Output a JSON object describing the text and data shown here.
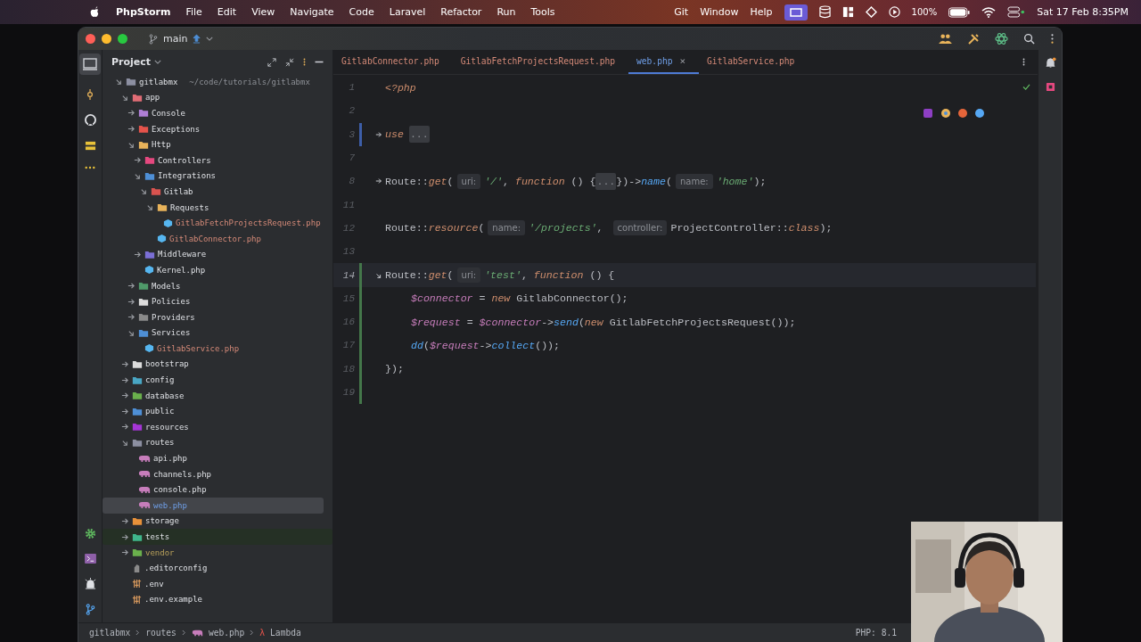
{
  "menu_bar": {
    "app": "PhpStorm",
    "items": [
      "File",
      "Edit",
      "View",
      "Navigate",
      "Code",
      "Laravel",
      "Refactor",
      "Run",
      "Tools"
    ],
    "right_items": [
      "Git",
      "Window",
      "Help"
    ],
    "battery": "100%",
    "clock": "Sat 17 Feb  8:35PM"
  },
  "title_bar": {
    "branch": "main"
  },
  "project": {
    "title": "Project",
    "tree": [
      {
        "name": "gitlabmx",
        "location": "~/code/tutorials/gitlabmx",
        "kind": "folder",
        "color": "#8c8fa1",
        "expanded": true,
        "selected": false,
        "unversioned": false,
        "modified": false,
        "excluded": false,
        "test_root": false,
        "children": [
          {
            "name": "app",
            "kind": "folder",
            "color": "#e06c75",
            "expanded": true,
            "selected": false,
            "unversioned": false,
            "modified": false,
            "excluded": false,
            "test_root": false,
            "children": [
              {
                "name": "Console",
                "kind": "folder",
                "color": "#b07fd6",
                "expanded": false,
                "selected": false,
                "unversioned": false,
                "modified": false,
                "excluded": false,
                "test_root": false
              },
              {
                "name": "Exceptions",
                "kind": "folder",
                "color": "#e5534b",
                "expanded": false,
                "selected": false,
                "unversioned": false,
                "modified": false,
                "excluded": false,
                "test_root": false
              },
              {
                "name": "Http",
                "kind": "folder",
                "color": "#e8b35a",
                "expanded": true,
                "selected": false,
                "unversioned": false,
                "modified": false,
                "excluded": false,
                "test_root": false,
                "children": [
                  {
                    "name": "Controllers",
                    "kind": "folder",
                    "color": "#e5487f",
                    "expanded": false,
                    "selected": false,
                    "unversioned": false,
                    "modified": false,
                    "excluded": false,
                    "test_root": false
                  },
                  {
                    "name": "Integrations",
                    "kind": "folder",
                    "color": "#4e8fd6",
                    "expanded": true,
                    "selected": false,
                    "unversioned": false,
                    "modified": false,
                    "excluded": false,
                    "test_root": false,
                    "children": [
                      {
                        "name": "Gitlab",
                        "kind": "folder",
                        "color": "#d9534f",
                        "expanded": true,
                        "selected": false,
                        "unversioned": false,
                        "modified": false,
                        "excluded": false,
                        "test_root": false,
                        "children": [
                          {
                            "name": "Requests",
                            "kind": "folder",
                            "color": "#e8b35a",
                            "expanded": true,
                            "selected": false,
                            "unversioned": false,
                            "modified": false,
                            "excluded": false,
                            "test_root": false,
                            "children": [
                              {
                                "name": "GitlabFetchProjectsRequest.php",
                                "kind": "php",
                                "color": "#56b6f0",
                                "selected": false,
                                "unversioned": true,
                                "modified": false,
                                "excluded": false,
                                "test_root": false
                              }
                            ]
                          },
                          {
                            "name": "GitlabConnector.php",
                            "kind": "php",
                            "color": "#56b6f0",
                            "selected": false,
                            "unversioned": true,
                            "modified": false,
                            "excluded": false,
                            "test_root": false
                          }
                        ]
                      }
                    ]
                  },
                  {
                    "name": "Middleware",
                    "kind": "folder",
                    "color": "#7b6fd6",
                    "expanded": false,
                    "selected": false,
                    "unversioned": false,
                    "modified": false,
                    "excluded": false,
                    "test_root": false
                  },
                  {
                    "name": "Kernel.php",
                    "kind": "php",
                    "color": "#56b6f0",
                    "selected": false,
                    "unversioned": false,
                    "modified": false,
                    "excluded": false,
                    "test_root": false
                  }
                ]
              },
              {
                "name": "Models",
                "kind": "folder",
                "color": "#4f9a6a",
                "expanded": false,
                "selected": false,
                "unversioned": false,
                "modified": false,
                "excluded": false,
                "test_root": false
              },
              {
                "name": "Policies",
                "kind": "folder",
                "color": "#dcdcdc",
                "expanded": false,
                "selected": false,
                "unversioned": false,
                "modified": false,
                "excluded": false,
                "test_root": false
              },
              {
                "name": "Providers",
                "kind": "folder",
                "color": "#8a8a8a",
                "expanded": false,
                "selected": false,
                "unversioned": false,
                "modified": false,
                "excluded": false,
                "test_root": false
              },
              {
                "name": "Services",
                "kind": "folder",
                "color": "#4e8fd6",
                "expanded": true,
                "selected": false,
                "unversioned": false,
                "modified": false,
                "excluded": false,
                "test_root": false,
                "children": [
                  {
                    "name": "GitlabService.php",
                    "kind": "php",
                    "color": "#56b6f0",
                    "selected": false,
                    "unversioned": true,
                    "modified": false,
                    "excluded": false,
                    "test_root": false
                  }
                ]
              }
            ]
          },
          {
            "name": "bootstrap",
            "kind": "folder",
            "color": "#dcdcdc",
            "expanded": false,
            "selected": false,
            "unversioned": false,
            "modified": false,
            "excluded": false,
            "test_root": false
          },
          {
            "name": "config",
            "kind": "folder",
            "color": "#49a6c4",
            "expanded": false,
            "selected": false,
            "unversioned": false,
            "modified": false,
            "excluded": false,
            "test_root": false
          },
          {
            "name": "database",
            "kind": "folder",
            "color": "#6ab04c",
            "expanded": false,
            "selected": false,
            "unversioned": false,
            "modified": false,
            "excluded": false,
            "test_root": false
          },
          {
            "name": "public",
            "kind": "folder",
            "color": "#4e8fd6",
            "expanded": false,
            "selected": false,
            "unversioned": false,
            "modified": false,
            "excluded": false,
            "test_root": false
          },
          {
            "name": "resources",
            "kind": "folder",
            "color": "#a535d6",
            "expanded": false,
            "selected": false,
            "unversioned": false,
            "modified": false,
            "excluded": false,
            "test_root": false
          },
          {
            "name": "routes",
            "kind": "folder",
            "color": "#8c8fa1",
            "expanded": true,
            "selected": false,
            "unversioned": false,
            "modified": false,
            "excluded": false,
            "test_root": false,
            "children": [
              {
                "name": "api.php",
                "kind": "laravel",
                "color": "#c77dbb",
                "selected": false,
                "unversioned": false,
                "modified": false,
                "excluded": false,
                "test_root": false
              },
              {
                "name": "channels.php",
                "kind": "laravel",
                "color": "#c77dbb",
                "selected": false,
                "unversioned": false,
                "modified": false,
                "excluded": false,
                "test_root": false
              },
              {
                "name": "console.php",
                "kind": "laravel",
                "color": "#c77dbb",
                "selected": false,
                "unversioned": false,
                "modified": false,
                "excluded": false,
                "test_root": false
              },
              {
                "name": "web.php",
                "kind": "laravel",
                "color": "#c77dbb",
                "selected": true,
                "unversioned": false,
                "modified": true,
                "excluded": false,
                "test_root": false
              }
            ]
          },
          {
            "name": "storage",
            "kind": "folder",
            "color": "#e8913a",
            "expanded": false,
            "selected": false,
            "unversioned": false,
            "modified": false,
            "excluded": false,
            "test_root": false
          },
          {
            "name": "tests",
            "kind": "folder",
            "color": "#3fb68b",
            "expanded": false,
            "selected": false,
            "unversioned": false,
            "modified": false,
            "excluded": false,
            "test_root": true
          },
          {
            "name": "vendor",
            "kind": "folder",
            "color": "#6ab04c",
            "expanded": false,
            "selected": false,
            "unversioned": false,
            "modified": false,
            "excluded": true,
            "test_root": false
          },
          {
            "name": ".editorconfig",
            "kind": "config",
            "color": "#8a8a8a",
            "selected": false,
            "unversioned": false,
            "modified": false,
            "excluded": false,
            "test_root": false
          },
          {
            "name": ".env",
            "kind": "env",
            "color": "#d99a5e",
            "selected": false,
            "unversioned": false,
            "modified": false,
            "excluded": false,
            "test_root": false
          },
          {
            "name": ".env.example",
            "kind": "env",
            "color": "#d99a5e",
            "selected": false,
            "unversioned": false,
            "modified": false,
            "excluded": false,
            "test_root": false
          }
        ]
      }
    ]
  },
  "tabs": [
    {
      "label": "GitlabConnector.php",
      "unversioned": true,
      "modified": false,
      "selected": false
    },
    {
      "label": "GitlabFetchProjectsRequest.php",
      "unversioned": true,
      "modified": false,
      "selected": false
    },
    {
      "label": "web.php",
      "unversioned": false,
      "modified": true,
      "selected": true,
      "close": "×"
    },
    {
      "label": "GitlabService.php",
      "unversioned": true,
      "modified": false,
      "selected": false
    }
  ],
  "code": [
    {
      "number": "1",
      "current": false,
      "modified": false,
      "added": false,
      "tokens": [
        {
          "kind": "keyword",
          "text": "<?php"
        }
      ]
    },
    {
      "number": "2",
      "current": false,
      "modified": false,
      "added": false
    },
    {
      "number": "3",
      "collapsed": true,
      "current": false,
      "modified": true,
      "added": false,
      "tokens": [
        {
          "kind": "keyword",
          "text": "use"
        },
        {
          "kind": "folded",
          "text": "..."
        }
      ]
    },
    {
      "number": "7",
      "current": false,
      "modified": false,
      "added": false
    },
    {
      "number": "8",
      "collapsed": true,
      "current": false,
      "modified": false,
      "added": false,
      "tokens": [
        {
          "kind": "plain",
          "text": "Route::"
        },
        {
          "kind": "keyword",
          "text": "get"
        },
        {
          "kind": "plain",
          "text": "("
        },
        {
          "kind": "hint",
          "text": "uri:"
        },
        {
          "kind": "string",
          "text": "'/'"
        },
        {
          "kind": "plain",
          "text": ", "
        },
        {
          "kind": "keyword",
          "text": "function"
        },
        {
          "kind": "plain",
          "text": " () {"
        },
        {
          "kind": "folded",
          "text": "..."
        },
        {
          "kind": "plain",
          "text": "})->"
        },
        {
          "kind": "method",
          "text": "name"
        },
        {
          "kind": "plain",
          "text": "("
        },
        {
          "kind": "hint",
          "text": "name:"
        },
        {
          "kind": "string",
          "text": "'home'"
        },
        {
          "kind": "plain",
          "text": ");"
        }
      ]
    },
    {
      "number": "11",
      "current": false,
      "modified": false,
      "added": false
    },
    {
      "number": "12",
      "current": false,
      "modified": false,
      "added": false,
      "tokens": [
        {
          "kind": "plain",
          "text": "Route::"
        },
        {
          "kind": "keyword",
          "text": "resource"
        },
        {
          "kind": "plain",
          "text": "("
        },
        {
          "kind": "hint",
          "text": "name:"
        },
        {
          "kind": "string",
          "text": "'/projects'"
        },
        {
          "kind": "plain",
          "text": ", "
        },
        {
          "kind": "hint",
          "text": "controller:"
        },
        {
          "kind": "plain",
          "text": "ProjectController::"
        },
        {
          "kind": "keyword",
          "text": "class"
        },
        {
          "kind": "plain",
          "text": ");"
        }
      ]
    },
    {
      "number": "13",
      "current": false,
      "modified": false,
      "added": false
    },
    {
      "number": "14",
      "collapsed": false,
      "current": true,
      "modified": false,
      "added": true,
      "tokens": [
        {
          "kind": "plain",
          "text": "Route::"
        },
        {
          "kind": "keyword",
          "text": "get"
        },
        {
          "kind": "plain",
          "text": "("
        },
        {
          "kind": "hint",
          "text": "uri:"
        },
        {
          "kind": "string",
          "text": "'test'"
        },
        {
          "kind": "plain",
          "text": ", "
        },
        {
          "kind": "keyword",
          "text": "function"
        },
        {
          "kind": "plain",
          "text": " () {"
        }
      ],
      "children": [
        {
          "number": "15",
          "current": false,
          "modified": false,
          "added": true,
          "tokens": [
            {
              "kind": "variable",
              "text": "$connector"
            },
            {
              "kind": "plain",
              "text": " = "
            },
            {
              "kind": "keyword",
              "text": "new"
            },
            {
              "kind": "plain",
              "text": " GitlabConnector();"
            }
          ]
        },
        {
          "number": "16",
          "current": false,
          "modified": false,
          "added": true,
          "tokens": [
            {
              "kind": "variable",
              "text": "$request"
            },
            {
              "kind": "plain",
              "text": " = "
            },
            {
              "kind": "variable",
              "text": "$connector"
            },
            {
              "kind": "plain",
              "text": "->"
            },
            {
              "kind": "method",
              "text": "send"
            },
            {
              "kind": "plain",
              "text": "("
            },
            {
              "kind": "keyword",
              "text": "new"
            },
            {
              "kind": "plain",
              "text": " GitlabFetchProjectsRequest());"
            }
          ]
        },
        {
          "number": "17",
          "current": false,
          "modified": false,
          "added": true,
          "tokens": [
            {
              "kind": "method",
              "text": "dd"
            },
            {
              "kind": "plain",
              "text": "("
            },
            {
              "kind": "variable",
              "text": "$request"
            },
            {
              "kind": "plain",
              "text": "->"
            },
            {
              "kind": "method",
              "text": "collect"
            },
            {
              "kind": "plain",
              "text": "());"
            }
          ]
        }
      ]
    },
    {
      "number": "18",
      "current": false,
      "modified": false,
      "added": true,
      "tokens": [
        {
          "kind": "plain",
          "text": "});"
        }
      ]
    },
    {
      "number": "19",
      "current": false,
      "modified": false,
      "added": true
    }
  ],
  "status_bar": {
    "breadcrumbs": [
      {
        "kind": "project",
        "text": "gitlabmx"
      },
      {
        "kind": "folder",
        "text": "routes"
      },
      {
        "kind": "file",
        "text": "web.php"
      },
      {
        "kind": "lambda",
        "text": "Lambda"
      }
    ],
    "lambda_icon": "λ",
    "php_version": "PHP: 8.1"
  }
}
